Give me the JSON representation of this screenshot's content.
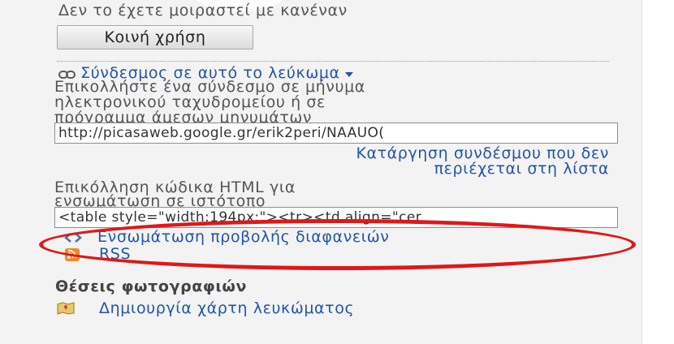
{
  "share": {
    "not_shared_text": "Δεν το έχετε μοιραστεί με κανέναν",
    "share_button": "Κοινή χρήση"
  },
  "link_section": {
    "title": "Σύνδεσμος σε αυτό το λεύκωμα",
    "instructions": [
      "Επικολλήστε ένα σύνδεσμο σε μήνυμα",
      "ηλεκτρονικού ταχυδρομείου ή σε",
      "πρόγραμμα άμεσων μηνυμάτων"
    ],
    "url_value": "http://picasaweb.google.gr/erik2peri/NAAUO(",
    "remove_link": [
      "Κατάργηση συνδέσμου που δεν",
      "περιέχεται στη λίστα"
    ],
    "embed_instructions": [
      "Επικόλληση κώδικα HTML για",
      "ενσωμάτωση σε ιστότοπο"
    ],
    "embed_code_value": "<table style=\"width:194px;\"><tr><td align=\"cer"
  },
  "actions": {
    "embed_slideshow": "Ενσωμάτωση προβολής διαφανειών",
    "rss": "RSS"
  },
  "places": {
    "heading": "Θέσεις φωτογραφιών",
    "create_map": "Δημιουργία χάρτη λευκώματος"
  },
  "colors": {
    "link": "#2255aa",
    "highlight_ellipse": "#e01818",
    "rss_orange": "#f08a24"
  },
  "icons": [
    "link-chain-icon",
    "dropdown-arrow-icon",
    "embed-slideshow-icon",
    "rss-icon",
    "map-icon"
  ]
}
